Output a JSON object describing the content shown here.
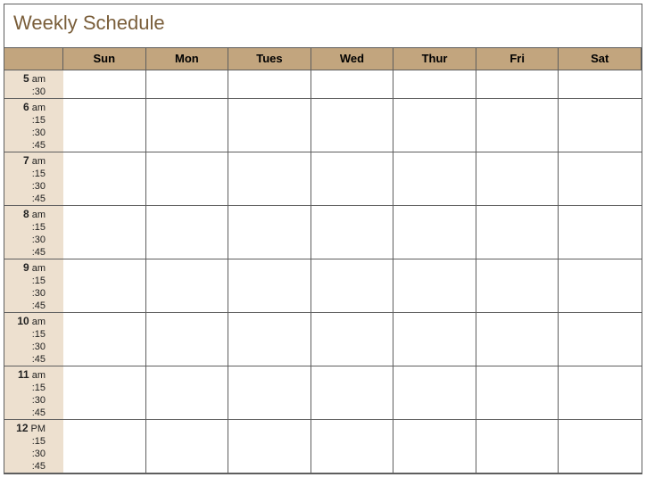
{
  "title": "Weekly Schedule",
  "days": [
    "Sun",
    "Mon",
    "Tues",
    "Wed",
    "Thur",
    "Fri",
    "Sat"
  ],
  "slots": [
    {
      "hour": "5",
      "suffix": "am",
      "subs": [
        ":30"
      ]
    },
    {
      "hour": "6",
      "suffix": "am",
      "subs": [
        ":15",
        ":30",
        ":45"
      ]
    },
    {
      "hour": "7",
      "suffix": "am",
      "subs": [
        ":15",
        ":30",
        ":45"
      ]
    },
    {
      "hour": "8",
      "suffix": "am",
      "subs": [
        ":15",
        ":30",
        ":45"
      ]
    },
    {
      "hour": "9",
      "suffix": "am",
      "subs": [
        ":15",
        ":30",
        ":45"
      ]
    },
    {
      "hour": "10",
      "suffix": "am",
      "subs": [
        ":15",
        ":30",
        ":45"
      ]
    },
    {
      "hour": "11",
      "suffix": "am",
      "subs": [
        ":15",
        ":30",
        ":45"
      ]
    },
    {
      "hour": "12",
      "suffix": "PM",
      "subs": [
        ":15",
        ":30",
        ":45"
      ]
    }
  ]
}
